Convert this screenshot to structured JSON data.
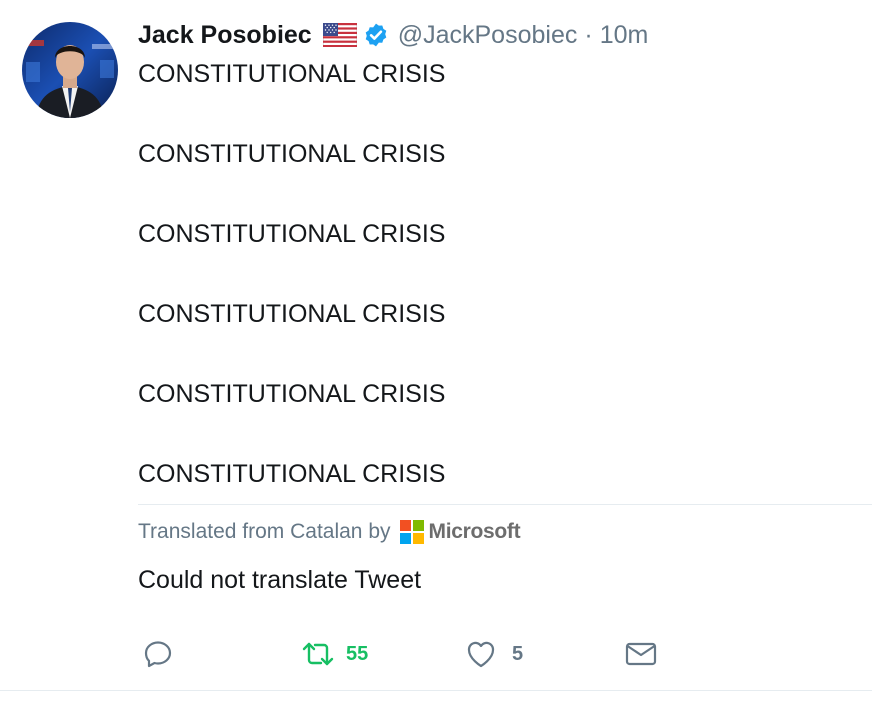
{
  "tweet": {
    "display_name": "Jack Posobiec",
    "handle": "@JackPosobiec",
    "separator": "·",
    "timestamp": "10m",
    "flag_icon": "us-flag-icon",
    "verified_icon": "verified-badge-icon",
    "lines": [
      "CONSTITUTIONAL CRISIS",
      "CONSTITUTIONAL CRISIS",
      "CONSTITUTIONAL CRISIS",
      "CONSTITUTIONAL CRISIS",
      "CONSTITUTIONAL CRISIS",
      "CONSTITUTIONAL CRISIS"
    ]
  },
  "translation": {
    "label": "Translated from Catalan by",
    "provider": "Microsoft",
    "result": "Could not translate Tweet"
  },
  "actions": {
    "reply": {
      "icon": "reply-icon",
      "count": ""
    },
    "retweet": {
      "icon": "retweet-icon",
      "count": "55"
    },
    "like": {
      "icon": "heart-icon",
      "count": "5"
    },
    "dm": {
      "icon": "envelope-icon"
    }
  },
  "colors": {
    "text": "#14171a",
    "secondary": "#657786",
    "verified": "#1da1f2",
    "retweet_green": "#17bf63",
    "divider": "#e6ecf0"
  }
}
